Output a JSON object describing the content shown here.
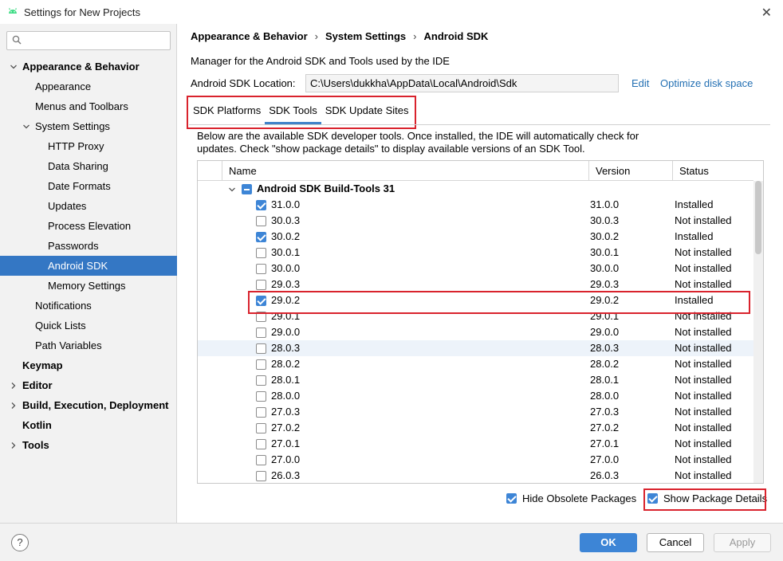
{
  "window": {
    "title": "Settings for New Projects"
  },
  "sidebar": {
    "search_placeholder": "",
    "items": [
      {
        "label": "Appearance & Behavior",
        "level": 0,
        "bold": true,
        "expanded": true
      },
      {
        "label": "Appearance",
        "level": 1
      },
      {
        "label": "Menus and Toolbars",
        "level": 1
      },
      {
        "label": "System Settings",
        "level": 1,
        "expanded": true
      },
      {
        "label": "HTTP Proxy",
        "level": 2
      },
      {
        "label": "Data Sharing",
        "level": 2
      },
      {
        "label": "Date Formats",
        "level": 2
      },
      {
        "label": "Updates",
        "level": 2
      },
      {
        "label": "Process Elevation",
        "level": 2
      },
      {
        "label": "Passwords",
        "level": 2
      },
      {
        "label": "Android SDK",
        "level": 2,
        "selected": true
      },
      {
        "label": "Memory Settings",
        "level": 2
      },
      {
        "label": "Notifications",
        "level": 1
      },
      {
        "label": "Quick Lists",
        "level": 1
      },
      {
        "label": "Path Variables",
        "level": 1
      },
      {
        "label": "Keymap",
        "level": 0,
        "bold": true
      },
      {
        "label": "Editor",
        "level": 0,
        "bold": true,
        "expanded": false
      },
      {
        "label": "Build, Execution, Deployment",
        "level": 0,
        "bold": true,
        "expanded": false
      },
      {
        "label": "Kotlin",
        "level": 0,
        "bold": true
      },
      {
        "label": "Tools",
        "level": 0,
        "bold": true,
        "expanded": false
      }
    ]
  },
  "main": {
    "breadcrumb": [
      "Appearance & Behavior",
      "System Settings",
      "Android SDK"
    ],
    "description": "Manager for the Android SDK and Tools used by the IDE",
    "location_label": "Android SDK Location:",
    "location_value": "C:\\Users\\dukkha\\AppData\\Local\\Android\\Sdk",
    "edit_link": "Edit",
    "optimize_link": "Optimize disk space",
    "tabs": [
      {
        "label": "SDK Platforms",
        "active": false
      },
      {
        "label": "SDK Tools",
        "active": true
      },
      {
        "label": "SDK Update Sites",
        "active": false
      }
    ],
    "info": "Below are the available SDK developer tools. Once installed, the IDE will automatically check for updates. Check \"show package details\" to display available versions of an SDK Tool.",
    "table": {
      "columns": {
        "name": "Name",
        "version": "Version",
        "status": "Status"
      },
      "group": "Android SDK Build-Tools 31",
      "rows": [
        {
          "name": "31.0.0",
          "version": "31.0.0",
          "status": "Installed",
          "checked": true
        },
        {
          "name": "30.0.3",
          "version": "30.0.3",
          "status": "Not installed",
          "checked": false
        },
        {
          "name": "30.0.2",
          "version": "30.0.2",
          "status": "Installed",
          "checked": true
        },
        {
          "name": "30.0.1",
          "version": "30.0.1",
          "status": "Not installed",
          "checked": false
        },
        {
          "name": "30.0.0",
          "version": "30.0.0",
          "status": "Not installed",
          "checked": false
        },
        {
          "name": "29.0.3",
          "version": "29.0.3",
          "status": "Not installed",
          "checked": false
        },
        {
          "name": "29.0.2",
          "version": "29.0.2",
          "status": "Installed",
          "checked": true,
          "highlighted": true
        },
        {
          "name": "29.0.1",
          "version": "29.0.1",
          "status": "Not installed",
          "checked": false
        },
        {
          "name": "29.0.0",
          "version": "29.0.0",
          "status": "Not installed",
          "checked": false
        },
        {
          "name": "28.0.3",
          "version": "28.0.3",
          "status": "Not installed",
          "checked": false,
          "hover": true
        },
        {
          "name": "28.0.2",
          "version": "28.0.2",
          "status": "Not installed",
          "checked": false
        },
        {
          "name": "28.0.1",
          "version": "28.0.1",
          "status": "Not installed",
          "checked": false
        },
        {
          "name": "28.0.0",
          "version": "28.0.0",
          "status": "Not installed",
          "checked": false
        },
        {
          "name": "27.0.3",
          "version": "27.0.3",
          "status": "Not installed",
          "checked": false
        },
        {
          "name": "27.0.2",
          "version": "27.0.2",
          "status": "Not installed",
          "checked": false
        },
        {
          "name": "27.0.1",
          "version": "27.0.1",
          "status": "Not installed",
          "checked": false
        },
        {
          "name": "27.0.0",
          "version": "27.0.0",
          "status": "Not installed",
          "checked": false
        },
        {
          "name": "26.0.3",
          "version": "26.0.3",
          "status": "Not installed",
          "checked": false
        }
      ]
    },
    "hide_obsolete": {
      "label": "Hide Obsolete Packages",
      "checked": true
    },
    "show_details": {
      "label": "Show Package Details",
      "checked": true
    }
  },
  "footer": {
    "help": "?",
    "ok": "OK",
    "cancel": "Cancel",
    "apply": "Apply"
  },
  "colors": {
    "accent": "#3d85d6",
    "selection": "#3477c4",
    "highlight_box": "#d9232d",
    "link": "#2470b3"
  }
}
